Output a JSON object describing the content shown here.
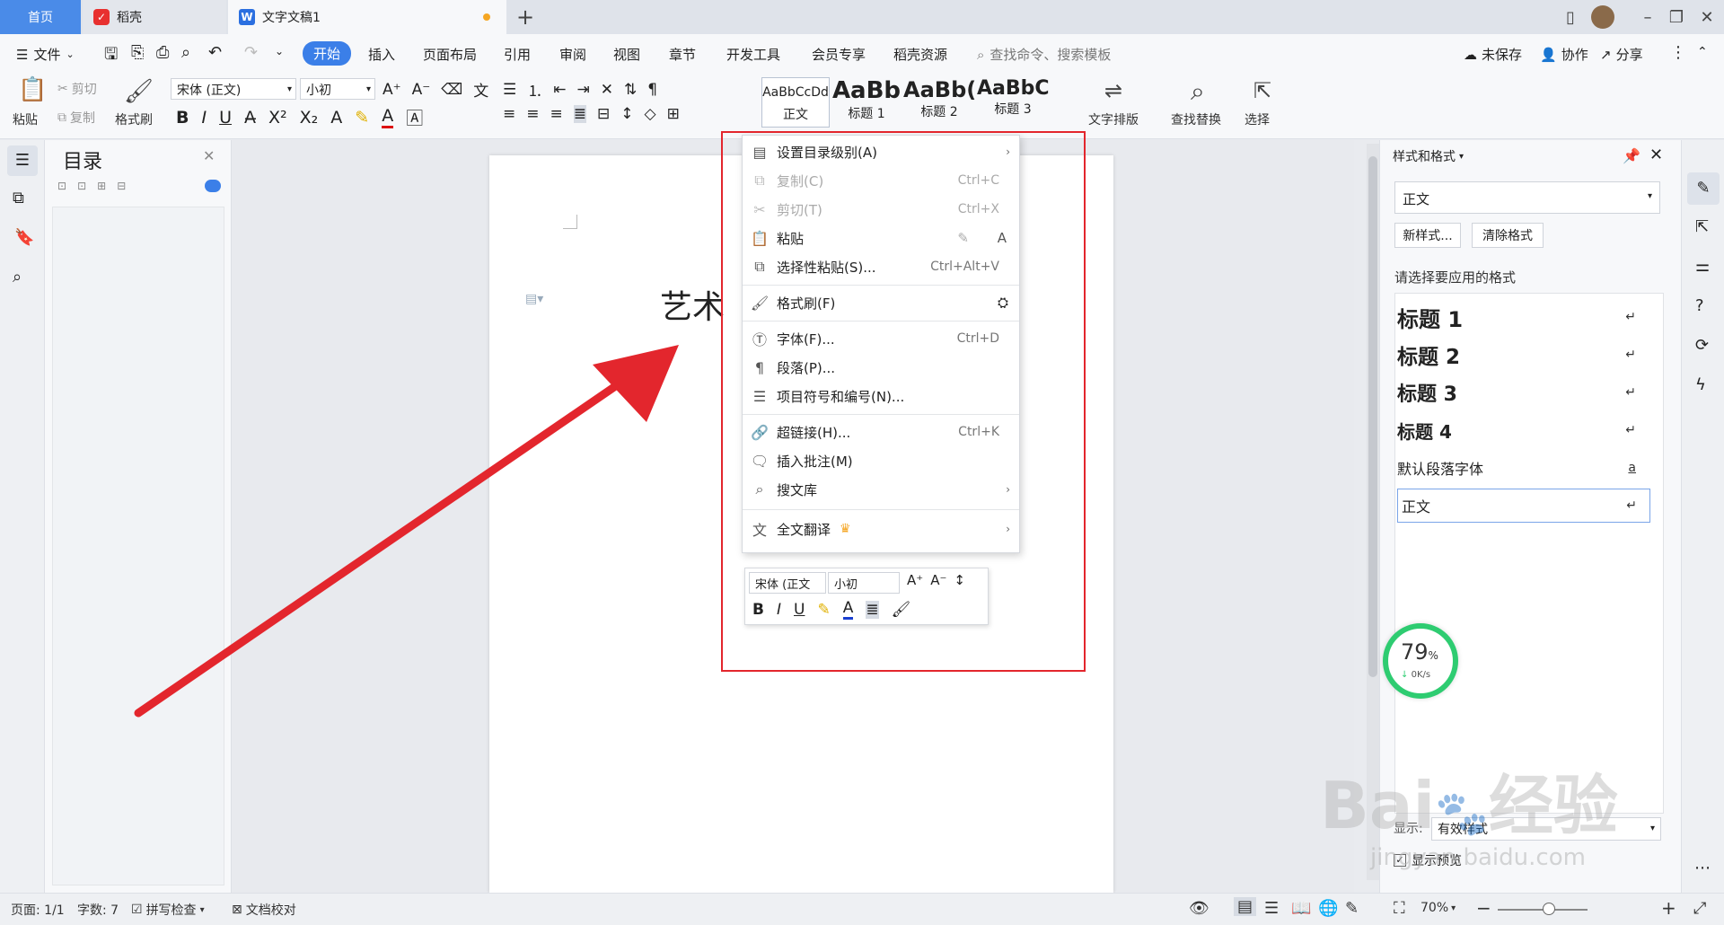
{
  "titlebar": {
    "tabs": [
      {
        "label": "首页"
      },
      {
        "label": "稻壳"
      },
      {
        "label": "文字文稿1"
      }
    ]
  },
  "menubar": {
    "file": "文件",
    "items": [
      "开始",
      "插入",
      "页面布局",
      "引用",
      "审阅",
      "视图",
      "章节",
      "开发工具",
      "会员专享",
      "稻壳资源"
    ],
    "search_placeholder": "查找命令、搜索模板",
    "unsaved": "未保存",
    "collab": "协作",
    "share": "分享"
  },
  "ribbon": {
    "paste": "粘贴",
    "cut": "剪切",
    "copy": "复制",
    "format_painter": "格式刷",
    "font_name": "宋体 (正文)",
    "font_size": "小初",
    "styles": [
      {
        "preview": "AaBbCcDd",
        "label": "正文"
      },
      {
        "preview": "AaBb",
        "label": "标题 1"
      },
      {
        "preview": "AaBb(",
        "label": "标题 2"
      },
      {
        "preview": "AaBbC",
        "label": "标题 3"
      }
    ],
    "text_layout": "文字排版",
    "find_replace": "查找替换",
    "select": "选择"
  },
  "toc": {
    "title": "目录"
  },
  "document": {
    "heading_visible": "艺术"
  },
  "context_menu": {
    "items": [
      {
        "label": "设置目录级别(A)",
        "shortcut": "",
        "submenu": true,
        "disabled": false,
        "icon": "toc-level-icon"
      },
      {
        "label": "复制(C)",
        "shortcut": "Ctrl+C",
        "submenu": false,
        "disabled": true,
        "icon": "copy-icon"
      },
      {
        "label": "剪切(T)",
        "shortcut": "Ctrl+X",
        "submenu": false,
        "disabled": true,
        "icon": "cut-icon"
      },
      {
        "label": "粘贴",
        "shortcut": "",
        "submenu": false,
        "disabled": false,
        "icon": "paste-icon"
      },
      {
        "label": "选择性粘贴(S)...",
        "shortcut": "Ctrl+Alt+V",
        "submenu": false,
        "disabled": false,
        "icon": "paste-special-icon"
      },
      {
        "label": "格式刷(F)",
        "shortcut": "",
        "submenu": false,
        "disabled": false,
        "icon": "format-painter-icon"
      },
      {
        "label": "字体(F)...",
        "shortcut": "Ctrl+D",
        "submenu": false,
        "disabled": false,
        "icon": "font-icon"
      },
      {
        "label": "段落(P)...",
        "shortcut": "",
        "submenu": false,
        "disabled": false,
        "icon": "paragraph-icon"
      },
      {
        "label": "项目符号和编号(N)...",
        "shortcut": "",
        "submenu": false,
        "disabled": false,
        "icon": "bullets-icon"
      },
      {
        "label": "超链接(H)...",
        "shortcut": "Ctrl+K",
        "submenu": false,
        "disabled": false,
        "icon": "hyperlink-icon"
      },
      {
        "label": "插入批注(M)",
        "shortcut": "",
        "submenu": false,
        "disabled": false,
        "icon": "comment-icon"
      },
      {
        "label": "搜文库",
        "shortcut": "",
        "submenu": true,
        "disabled": false,
        "icon": "search-library-icon"
      },
      {
        "label": "全文翻译",
        "shortcut": "",
        "submenu": true,
        "disabled": false,
        "icon": "translate-icon"
      }
    ]
  },
  "mini_toolbar": {
    "font_name": "宋体 (正文",
    "font_size": "小初"
  },
  "styles_pane": {
    "title": "样式和格式",
    "current_style": "正文",
    "new_style": "新样式...",
    "clear_format": "清除格式",
    "prompt": "请选择要应用的格式",
    "styles": [
      "标题 1",
      "标题 2",
      "标题 3",
      "标题 4",
      "默认段落字体",
      "正文"
    ],
    "show_label": "显示:",
    "show_value": "有效样式",
    "show_preview": "显示预览"
  },
  "speed_widget": {
    "percent": "79",
    "percent_sign": "%",
    "speed": "0K/s"
  },
  "statusbar": {
    "page": "页面: 1/1",
    "words": "字数: 7",
    "spell_check": "拼写检查",
    "doc_proof": "文档校对",
    "zoom": "70%"
  },
  "watermark": {
    "text1": "Bai",
    "text2": "经验",
    "text3": "jingyan.baidu.com"
  },
  "colors": {
    "accent": "#3b7fe8",
    "annotation_red": "#e3262d",
    "speed_green": "#2ecc71"
  }
}
